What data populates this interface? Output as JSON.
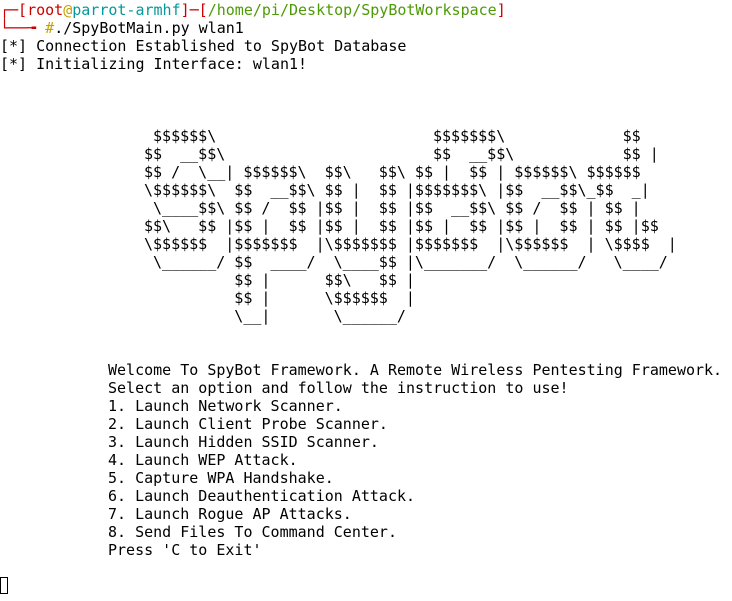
{
  "prompt": {
    "bracket_open_top": "┌─[",
    "user": "root",
    "at": "@",
    "host": "parrot-armhf",
    "sep": "]─[",
    "path": "/home/pi/Desktop/SpyBotWorkspace",
    "bracket_close": "]",
    "corner_bottom": "└──╼ ",
    "hash": "#",
    "command": "./SpyBotMain.py wlan1"
  },
  "status_lines": [
    "[*] Connection Established to SpyBot Database",
    "[*] Initializing Interface: wlan1!"
  ],
  "banner": [
    " $$$$$$\\                        $$$$$$$\\             $$",
    "$$  __$$\\                       $$  __$$\\            $$ |",
    "$$ /  \\__| $$$$$$\\  $$\\   $$\\ $$ |  $$ | $$$$$$\\ $$$$$$",
    "\\$$$$$$\\  $$  __$$\\ $$ |  $$ |$$$$$$$\\ |$$  __$$\\_$$  _|",
    " \\____$$\\ $$ /  $$ |$$ |  $$ |$$  __$$\\ $$ /  $$ | $$ |",
    "$$\\   $$ |$$ |  $$ |$$ |  $$ |$$ |  $$ |$$ |  $$ | $$ |$$",
    "\\$$$$$$  |$$$$$$$  |\\$$$$$$$ |$$$$$$$  |\\$$$$$$  | \\$$$$  |",
    " \\______/ $$  ____/  \\____$$ |\\_______/  \\______/   \\____/",
    "          $$ |      $$\\   $$ |",
    "          $$ |      \\$$$$$$  |",
    "          \\__|       \\______/"
  ],
  "menu": {
    "welcome": "Welcome To SpyBot Framework. A Remote Wireless Pentesting Framework.",
    "instruction": "Select an option and follow the instruction to use!",
    "options": [
      "1. Launch Network Scanner.",
      "2. Launch Client Probe Scanner.",
      "3. Launch Hidden SSID Scanner.",
      "4. Launch WEP Attack.",
      "5. Capture WPA Handshake.",
      "6. Launch Deauthentication Attack.",
      "7. Launch Rogue AP Attacks.",
      "8. Send Files To Command Center."
    ],
    "exit_hint": "Press 'C to Exit'"
  },
  "colors": {
    "bracket": "#cc0000",
    "host": "#06989a",
    "path": "#4e9a06",
    "hash": "#c4a000"
  }
}
